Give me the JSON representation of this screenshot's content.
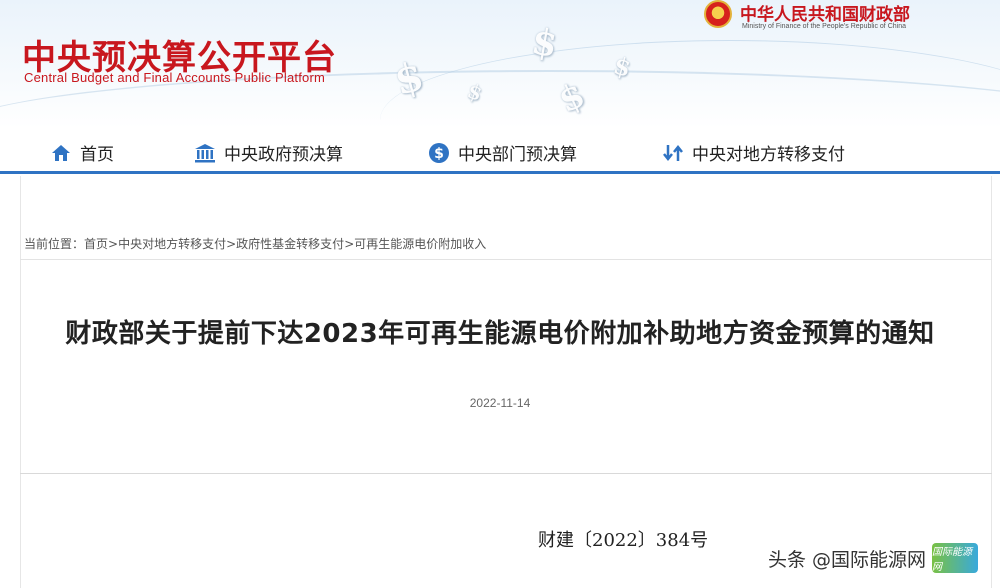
{
  "site": {
    "title_cn": "中央预决算公开平台",
    "title_en": "Central Budget and Final Accounts Public Platform"
  },
  "ministry": {
    "name_cn": "中华人民共和国财政部",
    "name_en": "Ministry of Finance of the People's Republic of China"
  },
  "nav": {
    "items": [
      {
        "label": "首页",
        "icon": "home-icon"
      },
      {
        "label": "中央政府预决算",
        "icon": "government-building-icon"
      },
      {
        "label": "中央部门预决算",
        "icon": "dollar-circle-icon"
      },
      {
        "label": "中央对地方转移支付",
        "icon": "transfer-arrows-icon"
      }
    ],
    "accent_color": "#2f73c3"
  },
  "breadcrumb": {
    "prefix": "当前位置：",
    "items": [
      "首页",
      "中央对地方转移支付",
      "政府性基金转移支付",
      "可再生能源电价附加收入"
    ],
    "separator": ">"
  },
  "article": {
    "title": "财政部关于提前下达2023年可再生能源电价附加补助地方资金预算的通知",
    "date": "2022-11-14",
    "doc_number": "财建〔2022〕384号"
  },
  "watermark": {
    "text": "头条 @国际能源网",
    "logo_text": "国际能源网"
  },
  "colors": {
    "brand_red": "#c8171e",
    "nav_blue": "#2f73c3"
  }
}
